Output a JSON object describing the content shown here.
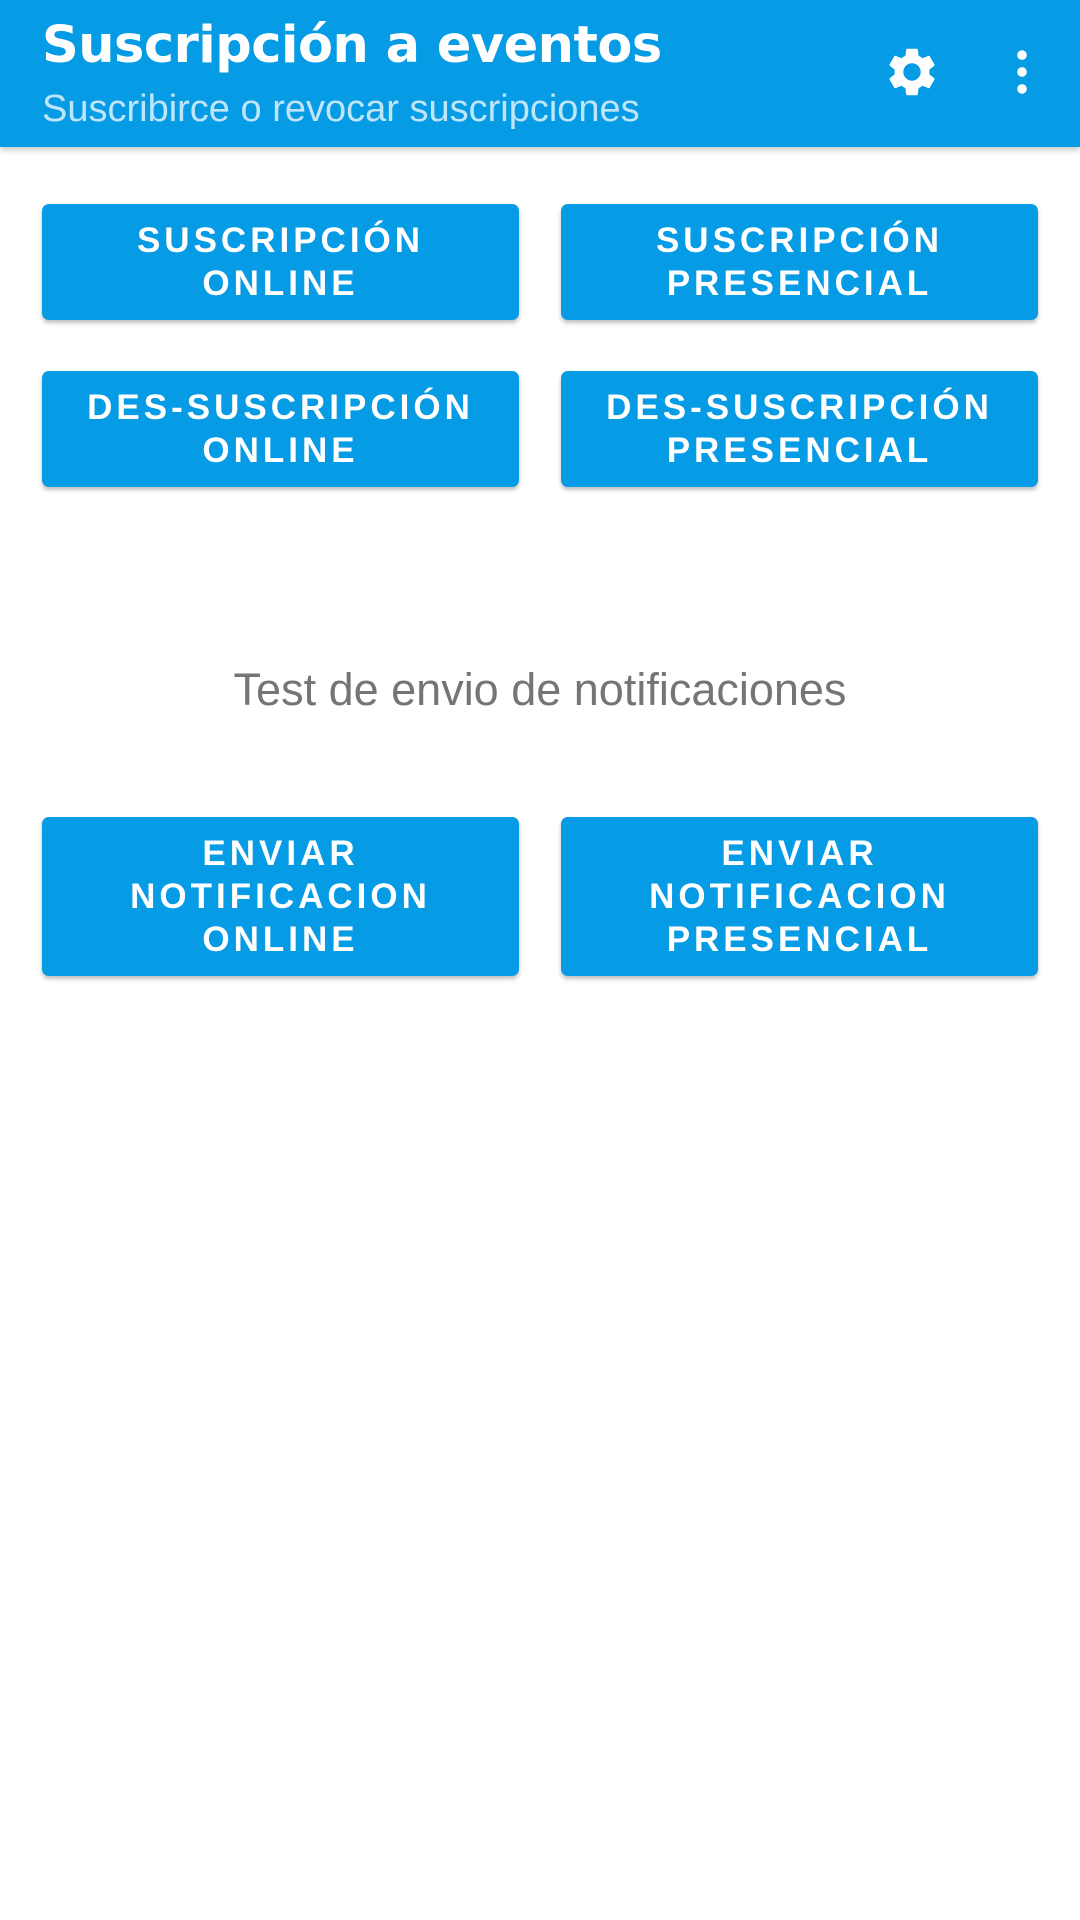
{
  "appbar": {
    "title": "Suscripción a eventos",
    "subtitle": "Suscribirce o revocar suscripciones",
    "settings_icon": "gear-icon",
    "more_icon": "more-vert-icon"
  },
  "subscriptions": {
    "subscribe_online": "SUSCRIPCIÓN\nONLINE",
    "subscribe_presencial": "SUSCRIPCIÓN\nPRESENCIAL",
    "unsubscribe_online": "DES-SUSCRIPCIÓN\nONLINE",
    "unsubscribe_presencial": "DES-SUSCRIPCIÓN\nPRESENCIAL"
  },
  "notifications": {
    "section_label": "Test de envio de notificaciones",
    "send_online": "ENVIAR\nNOTIFICACION\nONLINE",
    "send_presencial": "ENVIAR\nNOTIFICACION\nPRESENCIAL"
  },
  "colors": {
    "primary": "#069be5",
    "subtitle": "#bfe5fa",
    "section_text": "#757575",
    "background": "#ffffff"
  }
}
